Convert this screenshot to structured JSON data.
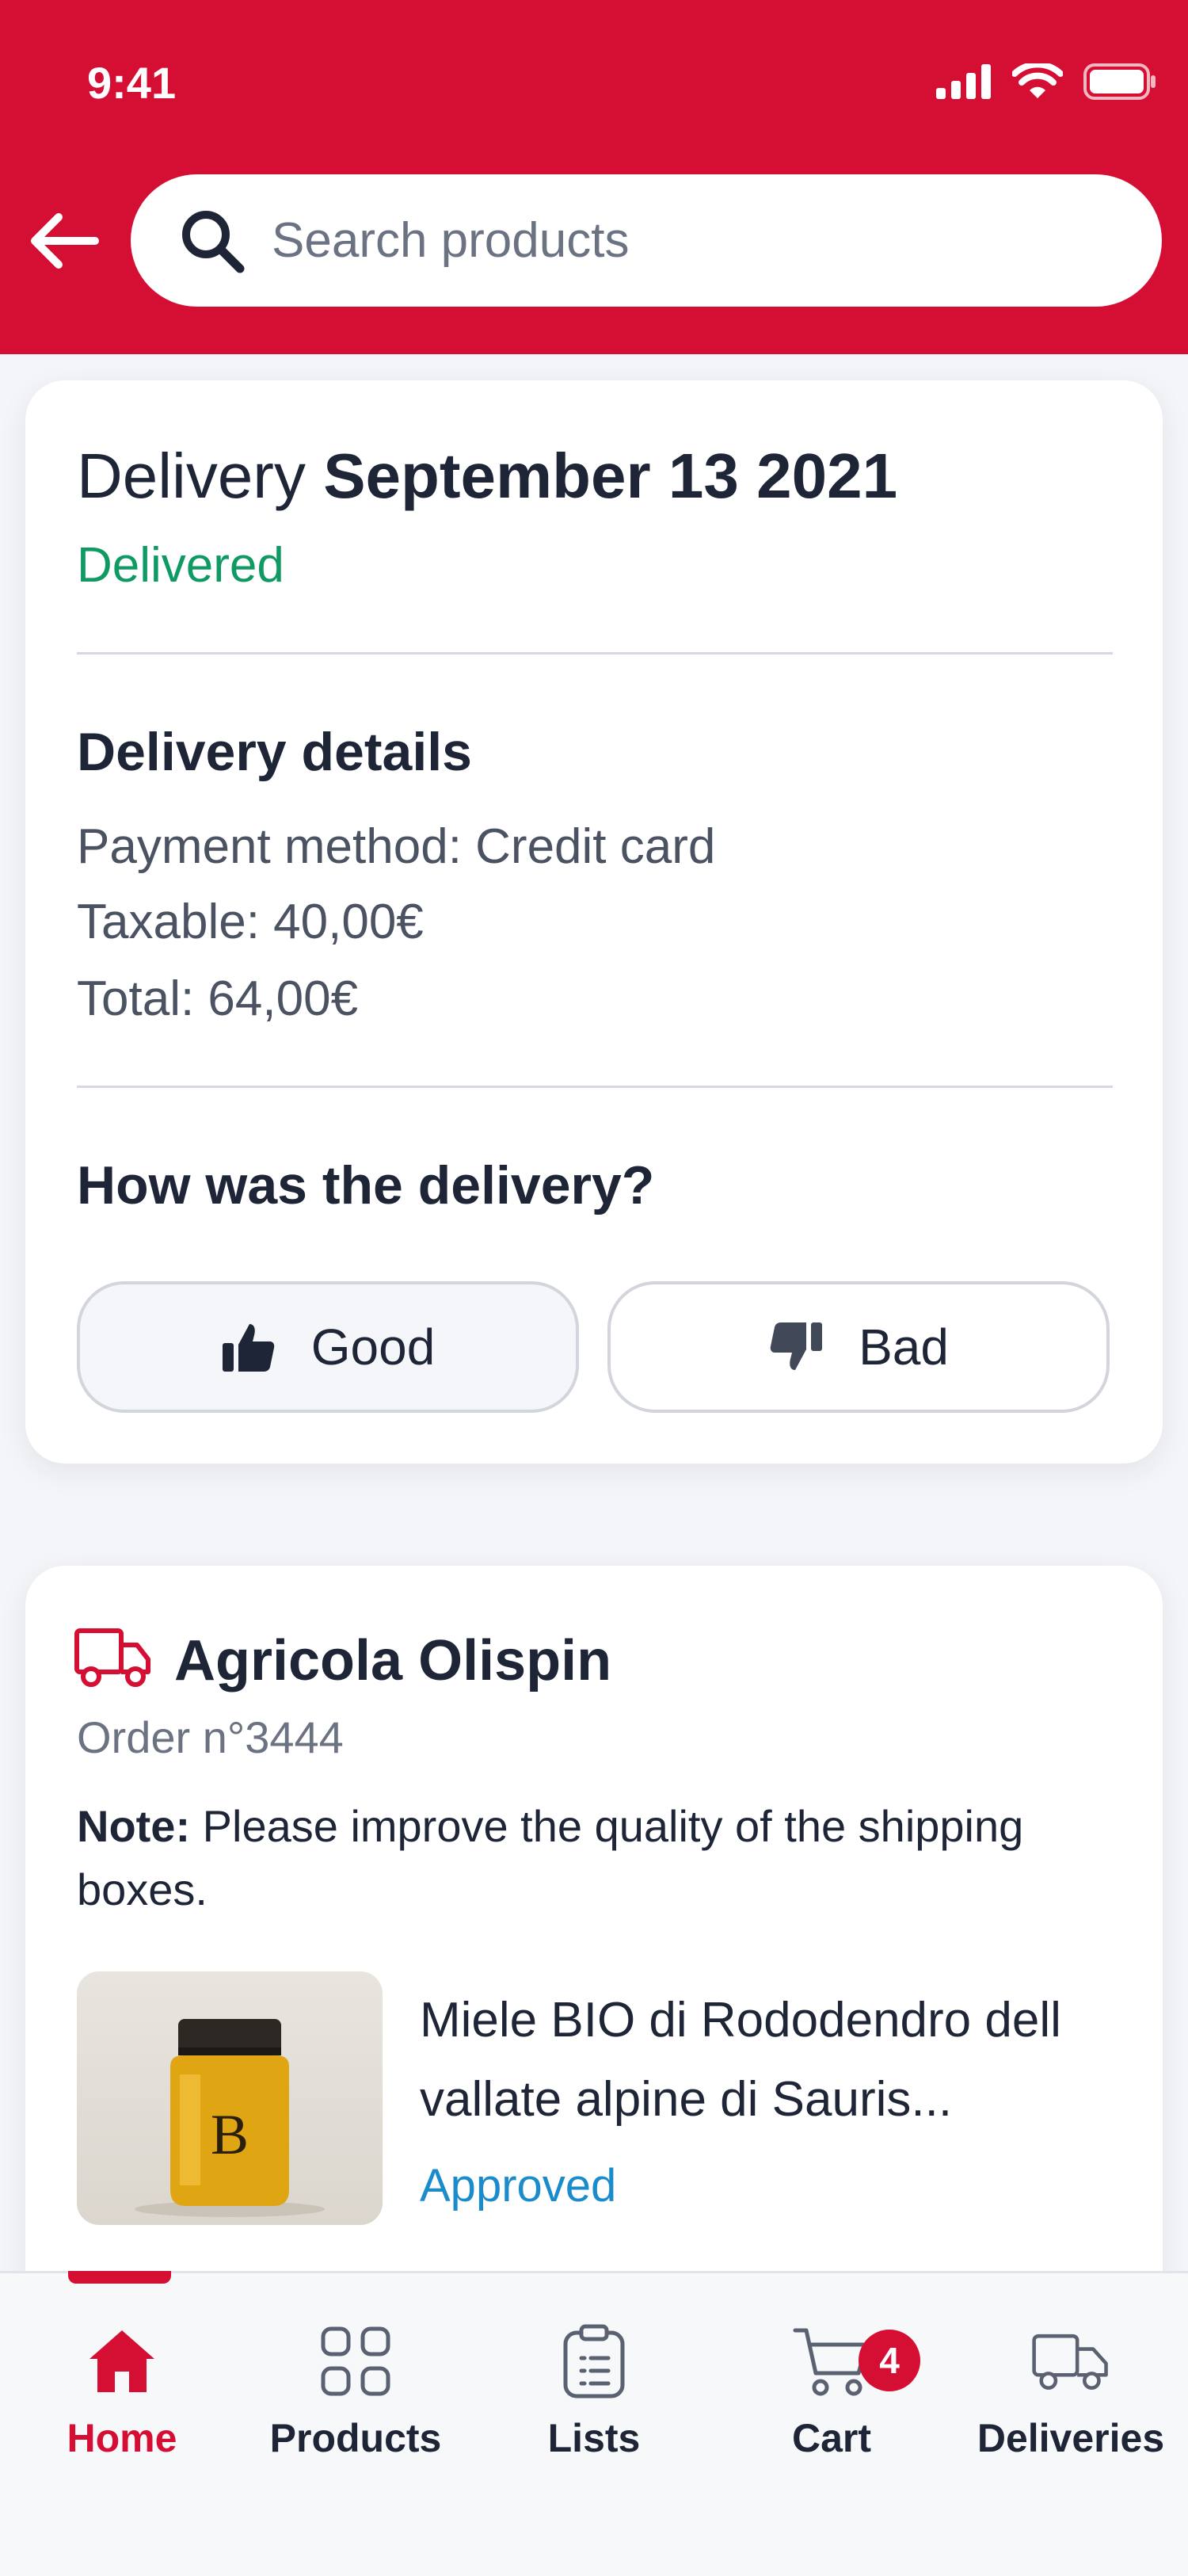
{
  "status_bar": {
    "time": "9:41"
  },
  "search": {
    "placeholder": "Search products"
  },
  "delivery": {
    "title_prefix": "Delivery",
    "date": "September 13 2021",
    "status": "Delivered",
    "details_title": "Delivery details",
    "payment_method": "Payment method: Credit card",
    "taxable": "Taxable: 40,00€",
    "total": "Total: 64,00€",
    "rating_question": "How was the delivery?",
    "good_label": "Good",
    "bad_label": "Bad"
  },
  "order": {
    "company": "Agricola Olispin",
    "order_number": "Order n°3444",
    "note_label": "Note:",
    "note_text": " Please improve the quality of the shipping boxes.",
    "product": {
      "name_line1": "Miele BIO di Rododendro dell",
      "name_line2": "vallate alpine di Sauris...",
      "status": "Approved",
      "image_icon": "honey-jar-image"
    }
  },
  "tabs": [
    {
      "label": "Home",
      "icon": "home-icon",
      "active": true
    },
    {
      "label": "Products",
      "icon": "grid-icon"
    },
    {
      "label": "Lists",
      "icon": "clipboard-icon"
    },
    {
      "label": "Cart",
      "icon": "cart-icon",
      "badge": "4"
    },
    {
      "label": "Deliveries",
      "icon": "truck-icon"
    }
  ],
  "colors": {
    "brand": "#D50E33",
    "delivered": "#0E9A62",
    "approved": "#1A8BCB"
  }
}
